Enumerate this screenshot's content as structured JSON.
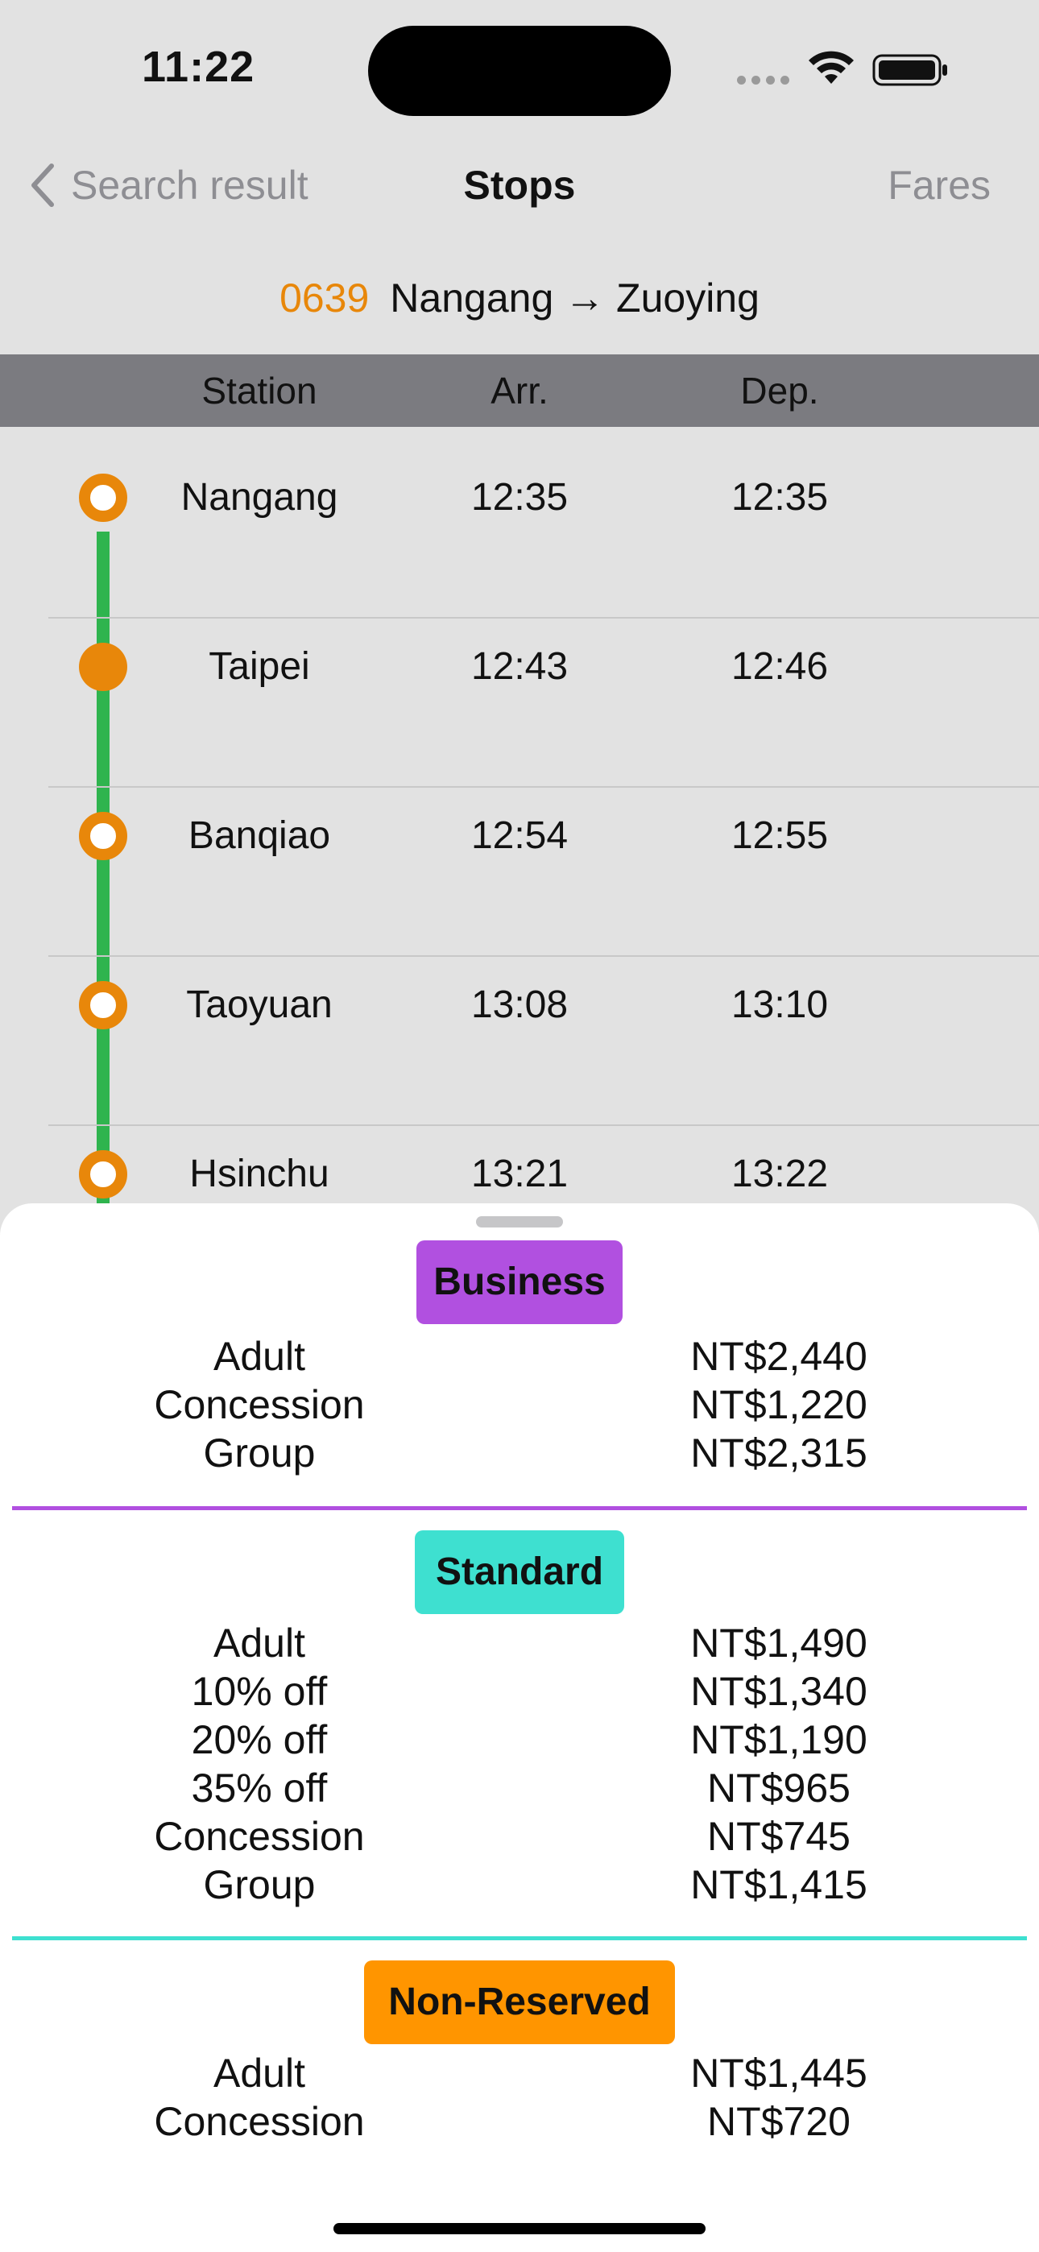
{
  "status_bar": {
    "time": "11:22"
  },
  "nav": {
    "back_label": "Search result",
    "title": "Stops",
    "action_label": "Fares"
  },
  "train": {
    "number": "0639",
    "route": "Nangang → Zuoying"
  },
  "table": {
    "headers": {
      "station": "Station",
      "arrival": "Arr.",
      "departure": "Dep."
    }
  },
  "stops": [
    {
      "station": "Nangang",
      "arrival": "12:35",
      "departure": "12:35",
      "marker": "hollow"
    },
    {
      "station": "Taipei",
      "arrival": "12:43",
      "departure": "12:46",
      "marker": "filled"
    },
    {
      "station": "Banqiao",
      "arrival": "12:54",
      "departure": "12:55",
      "marker": "hollow"
    },
    {
      "station": "Taoyuan",
      "arrival": "13:08",
      "departure": "13:10",
      "marker": "hollow"
    },
    {
      "station": "Hsinchu",
      "arrival": "13:21",
      "departure": "13:22",
      "marker": "hollow"
    }
  ],
  "colors": {
    "accent_orange": "#e8870a",
    "route_green": "#2fb44e",
    "business": "#b150e0",
    "standard": "#3ee0d0",
    "non_reserved": "#ff9500"
  },
  "fares": {
    "business": {
      "label": "Business",
      "rows": [
        {
          "type": "Adult",
          "price": "NT$2,440"
        },
        {
          "type": "Concession",
          "price": "NT$1,220"
        },
        {
          "type": "Group",
          "price": "NT$2,315"
        }
      ]
    },
    "standard": {
      "label": "Standard",
      "rows": [
        {
          "type": "Adult",
          "price": "NT$1,490"
        },
        {
          "type": "10% off",
          "price": "NT$1,340"
        },
        {
          "type": "20% off",
          "price": "NT$1,190"
        },
        {
          "type": "35% off",
          "price": "NT$965"
        },
        {
          "type": "Concession",
          "price": "NT$745"
        },
        {
          "type": "Group",
          "price": "NT$1,415"
        }
      ]
    },
    "non_reserved": {
      "label": "Non-Reserved",
      "rows": [
        {
          "type": "Adult",
          "price": "NT$1,445"
        },
        {
          "type": "Concession",
          "price": "NT$720"
        }
      ]
    }
  }
}
